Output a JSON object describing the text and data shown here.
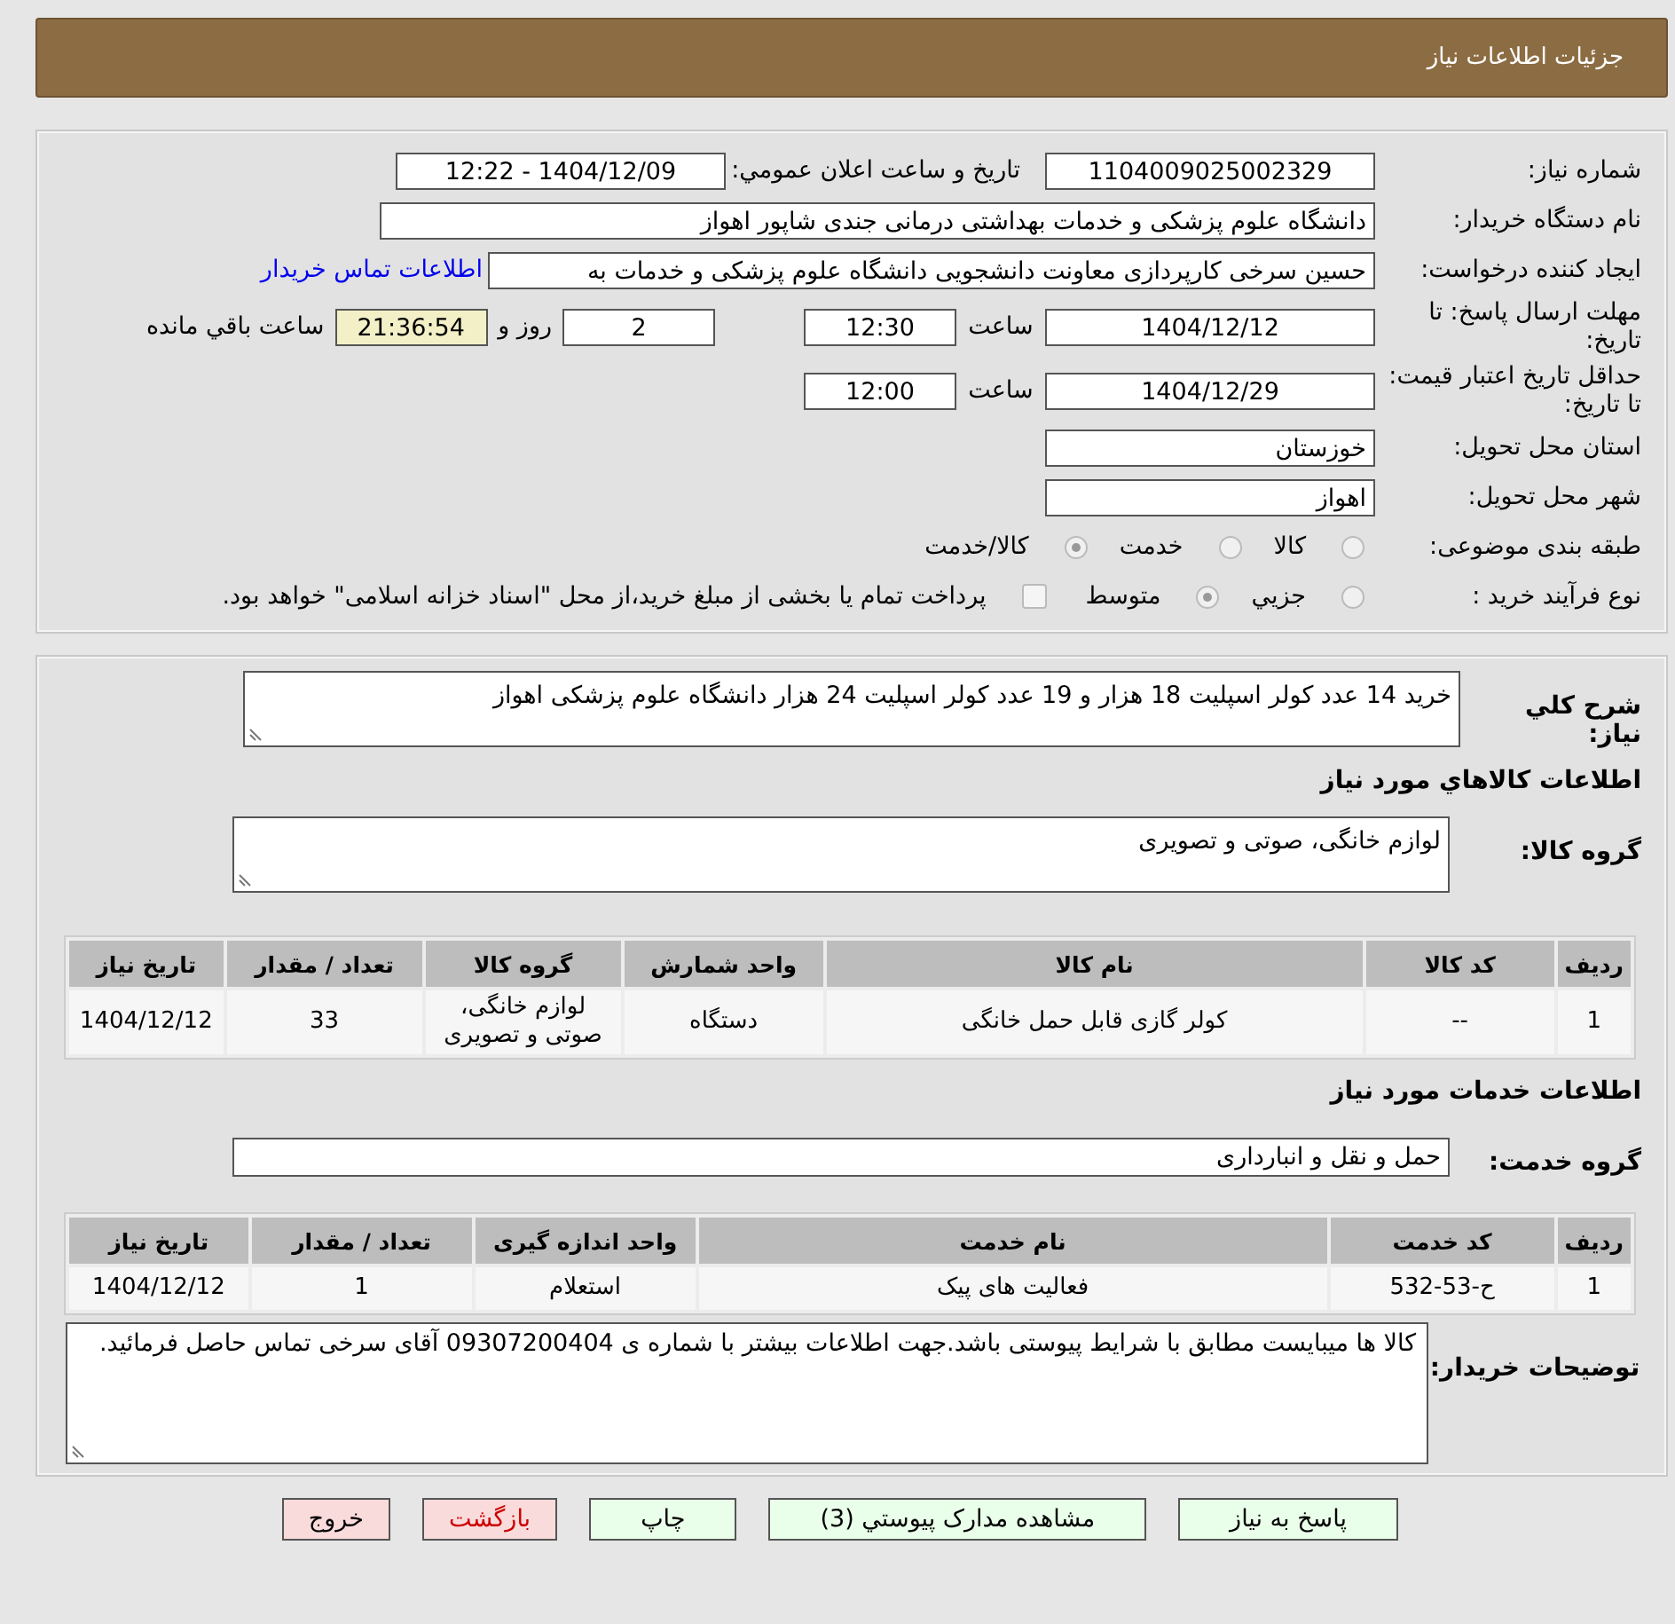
{
  "header": {
    "title": "جزئیات اطلاعات نیاز"
  },
  "need_info": {
    "need_number": {
      "label": "شماره نیاز:",
      "value": "1104009025002329"
    },
    "announce": {
      "label": "تاریخ و ساعت اعلان عمومي:",
      "value": "1404/12/09 - 12:22"
    },
    "buyer_org": {
      "label": "نام دستگاه خریدار:",
      "value": "دانشگاه علوم پزشکی و خدمات بهداشتی درمانی جندی شاپور اهواز"
    },
    "requester": {
      "label": "ایجاد کننده درخواست:",
      "value": "حسین سرخی کارپردازی معاونت دانشجویی دانشگاه علوم پزشکی و خدمات به",
      "link": "اطلاعات تماس خریدار"
    },
    "reply_deadline": {
      "label": "مهلت ارسال پاسخ: تا تاریخ:",
      "date": "1404/12/12",
      "time_label": "ساعت",
      "time": "12:30",
      "days": "2",
      "days_label": "روز و",
      "remaining": "21:36:54",
      "remaining_label": "ساعت باقي مانده"
    },
    "price_validity": {
      "label": "حداقل تاریخ اعتبار قیمت: تا تاریخ:",
      "date": "1404/12/29",
      "time_label": "ساعت",
      "time": "12:00"
    },
    "province": {
      "label": "استان محل تحویل:",
      "value": "خوزستان"
    },
    "city": {
      "label": "شهر محل تحویل:",
      "value": "اهواز"
    },
    "category": {
      "label": "طبقه بندی موضوعی:",
      "options": [
        {
          "label": "کالا",
          "selected": false
        },
        {
          "label": "خدمت",
          "selected": false
        },
        {
          "label": "کالا/خدمت",
          "selected": true
        }
      ]
    },
    "process": {
      "label": "نوع فرآیند خرید :",
      "options": [
        {
          "label": "جزيي",
          "selected": false
        },
        {
          "label": "متوسط",
          "selected": true
        }
      ],
      "treasury": {
        "label": "پرداخت تمام یا بخشی از مبلغ خرید،از محل \"اسناد خزانه اسلامی\" خواهد بود.",
        "checked": false
      }
    }
  },
  "details": {
    "description": {
      "label": "شرح كلي نياز:",
      "value": "خرید 14 عدد کولر اسپلیت 18 هزار و 19 عدد کولر اسپلیت 24 هزار دانشگاه علوم پزشکی اهواز"
    },
    "goods_heading": "اطلاعات كالاهاي مورد نياز",
    "goods_group": {
      "label": "گروه کالا:",
      "value": "لوازم خانگی، صوتی و تصویری"
    },
    "goods_table": {
      "columns": [
        "رديف",
        "کد کالا",
        "نام کالا",
        "واحد شمارش",
        "گروه کالا",
        "تعداد / مقدار",
        "تاریخ نیاز"
      ],
      "rows": [
        [
          "1",
          "--",
          "کولر گازی قابل حمل خانگی",
          "دستگاه",
          "لوازم خانگی، صوتی و تصویری",
          "33",
          "1404/12/12"
        ]
      ]
    },
    "services_heading": "اطلاعات خدمات مورد نياز",
    "service_group": {
      "label": "گروه خدمت:",
      "value": "حمل و نقل و انبارداری"
    },
    "services_table": {
      "columns": [
        "رديف",
        "کد خدمت",
        "نام خدمت",
        "واحد اندازه گیری",
        "تعداد / مقدار",
        "تاریخ نیاز"
      ],
      "rows": [
        [
          "1",
          "ح-53-532",
          "فعالیت های پیک",
          "استعلام",
          "1",
          "1404/12/12"
        ]
      ]
    },
    "notes": {
      "label": "توضیحات خریدار:",
      "value": "کالا ها میبایست مطابق با شرایط پیوستی باشد.جهت اطلاعات بیشتر با شماره ی 09307200404 آقای سرخی تماس حاصل فرمائید."
    }
  },
  "buttons": [
    {
      "label": "پاسخ به نياز",
      "kind": "action"
    },
    {
      "label": "مشاهده مدارک پيوستي (3)",
      "kind": "action"
    },
    {
      "label": "چاپ",
      "kind": "action"
    },
    {
      "label": "بازگشت",
      "kind": "back"
    },
    {
      "label": "خروج",
      "kind": "exit"
    }
  ]
}
